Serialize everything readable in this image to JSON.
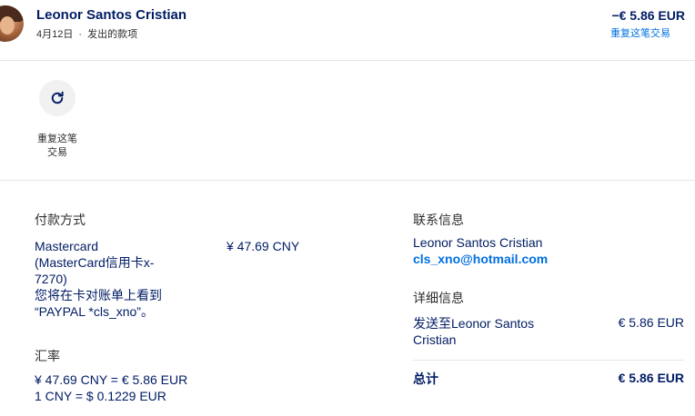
{
  "header": {
    "name": "Leonor Santos Cristian",
    "date": "4月12日",
    "separator": "·",
    "type": "发出的款项",
    "amount": "−€ 5.86 EUR",
    "repeat_link": "重复这笔交易"
  },
  "action": {
    "icon": "refresh-icon",
    "label_line1": "重复这笔",
    "label_line2": "交易"
  },
  "payment": {
    "title": "付款方式",
    "method_line1": "Mastercard",
    "method_line2": "(MasterCard信用卡x-",
    "method_line3": "7270)",
    "statement_line1": "您将在卡对账单上看到",
    "statement_line2": "“PAYPAL *cls_xno”。",
    "amount": "¥ 47.69 CNY"
  },
  "exchange": {
    "title": "汇率",
    "line1": "¥ 47.69 CNY = € 5.86 EUR",
    "line2": "1 CNY = $ 0.1229 EUR"
  },
  "contact": {
    "title": "联系信息",
    "name": "Leonor Santos Cristian",
    "email": "cls_xno@hotmail.com"
  },
  "details": {
    "title": "详细信息",
    "sent_line1": "发送至Leonor Santos",
    "sent_line2": "Cristian",
    "sent_amount": "€ 5.86 EUR",
    "total_label": "总计",
    "total_amount": "€ 5.86 EUR"
  },
  "colors": {
    "text_primary": "#001c64",
    "link": "#0070e0",
    "divider": "#e6e6e6"
  }
}
